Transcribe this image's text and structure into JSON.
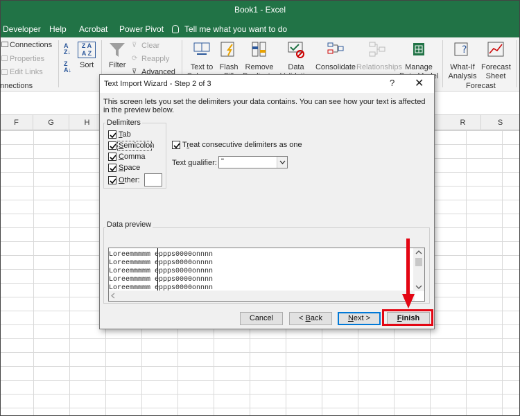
{
  "window": {
    "title": "Book1  -  Excel"
  },
  "ribbon_tabs": [
    "Developer",
    "Help",
    "Acrobat",
    "Power Pivot"
  ],
  "tell_me": "Tell me what you want to do",
  "ribbon": {
    "connections": "Connections",
    "properties": "Properties",
    "edit_links": "Edit Links",
    "connections_group": "nnections",
    "sort": "Sort",
    "filter": "Filter",
    "clear": "Clear",
    "reapply": "Reapply",
    "advanced": "Advanced",
    "text_to_columns": "Text to\nColumns",
    "flash_fill": "Flash\nFill",
    "remove_duplicates": "Remove\nDuplicates",
    "data_validation": "Data\nValidation",
    "consolidate": "Consolidate",
    "relationships": "Relationships",
    "manage_data_model": "Manage\nData Model",
    "what_if": "What-If\nAnalysis",
    "forecast_sheet": "Forecast\nSheet",
    "forecast_group": "Forecast"
  },
  "columns": {
    "left": [
      "F",
      "G",
      "H"
    ],
    "right": [
      "R",
      "S"
    ]
  },
  "dialog": {
    "title": "Text Import Wizard - Step 2 of 3",
    "help": "?",
    "close": "✕",
    "description": "This screen lets you set the delimiters your data contains.  You can see how your text is affected in the preview below.",
    "delimiters_label": "Delimiters",
    "delimiters": [
      {
        "key": "T",
        "rest": "ab",
        "checked": true
      },
      {
        "key": "S",
        "rest": "emicolon",
        "checked": true
      },
      {
        "key": "C",
        "rest": "omma",
        "checked": true
      },
      {
        "key": "S",
        "rest": "pace",
        "checked": true
      },
      {
        "key": "O",
        "rest": "ther:",
        "checked": true
      }
    ],
    "treat_consecutive": {
      "prefix": "T",
      "key": "r",
      "rest": "eat consecutive delimiters as one",
      "checked": true
    },
    "text_qualifier": {
      "prefix": "Text ",
      "key": "q",
      "rest": "ualifier:",
      "value": "\""
    },
    "data_preview_label": "Data preview",
    "preview_rows": [
      "Loreemmmmm eppps0000onnnn",
      "Loreemmmmm eppps0000onnnn",
      "Loreemmmmm eppps0000onnnn",
      "Loreemmmmm eppps0000onnnn",
      "Loreemmmmm eppps0000onnnn"
    ],
    "buttons": {
      "cancel": "Cancel",
      "back": {
        "prefix": "< ",
        "key": "B",
        "rest": "ack"
      },
      "next": {
        "key": "N",
        "rest": "ext >"
      },
      "finish": {
        "key": "F",
        "rest": "inish"
      }
    }
  },
  "colors": {
    "excel_green": "#217346",
    "highlight_red": "#e30613",
    "focus_blue": "#0078d7"
  }
}
